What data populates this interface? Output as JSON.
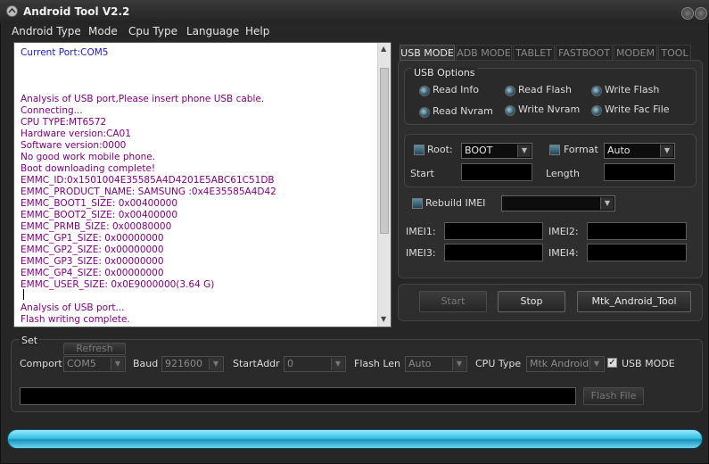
{
  "window": {
    "title": "Android Tool V2.2"
  },
  "menu": [
    "Android Type",
    "Mode",
    "Cpu Type",
    "Language",
    "Help"
  ],
  "log": {
    "lines": [
      {
        "text": "Current Port:COM5",
        "color": "#1a1ad0"
      },
      {
        "text": "",
        "color": "#800080"
      },
      {
        "text": "",
        "color": "#800080"
      },
      {
        "text": "",
        "color": "#800080"
      },
      {
        "text": "Analysis of USB port,Please insert phone USB cable.",
        "color": "#800080"
      },
      {
        "text": "Connecting...",
        "color": "#800080"
      },
      {
        "text": "CPU TYPE:MT6572",
        "color": "#800080"
      },
      {
        "text": "Hardware version:CA01",
        "color": "#800080"
      },
      {
        "text": "Software version:0000",
        "color": "#800080"
      },
      {
        "text": "No good work mobile phone.",
        "color": "#800080"
      },
      {
        "text": "Boot downloading complete!",
        "color": "#800080"
      },
      {
        "text": "EMMC_ID:0x1501004E35585A4D4201E5ABC61C51DB",
        "color": "#800080"
      },
      {
        "text": "EMMC_PRODUCT_NAME: SAMSUNG :0x4E35585A4D42",
        "color": "#800080"
      },
      {
        "text": "EMMC_BOOT1_SIZE: 0x00400000",
        "color": "#800080"
      },
      {
        "text": "EMMC_BOOT2_SIZE: 0x00400000",
        "color": "#800080"
      },
      {
        "text": "EMMC_PRMB_SIZE: 0x00080000",
        "color": "#800080"
      },
      {
        "text": "EMMC_GP1_SIZE: 0x00000000",
        "color": "#800080"
      },
      {
        "text": "EMMC_GP2_SIZE: 0x00000000",
        "color": "#800080"
      },
      {
        "text": "EMMC_GP3_SIZE: 0x00000000",
        "color": "#800080"
      },
      {
        "text": "EMMC_GP4_SIZE: 0x00000000",
        "color": "#800080"
      },
      {
        "text": "EMMC_USER_SIZE: 0x0E9000000(3.64 G)",
        "color": "#800080"
      },
      {
        "text": "",
        "color": "#800080"
      },
      {
        "text": "Analysis of USB port...",
        "color": "#800080"
      },
      {
        "text": "Flash writing complete.",
        "color": "#800080"
      }
    ]
  },
  "tabs": [
    "USB MODE",
    "ADB MODE",
    "TABLET",
    "FASTBOOT",
    "MODEM",
    "TOOL"
  ],
  "usb_options": {
    "title": "USB Options",
    "options": [
      "Read Info",
      "Read Flash",
      "Write Flash",
      "Read Nvram",
      "Write Nvram",
      "Write Fac File"
    ]
  },
  "root": {
    "label": "Root:",
    "value": "BOOT"
  },
  "format": {
    "label": "Format",
    "value": "Auto"
  },
  "start_label": "Start",
  "length_label": "Length",
  "rebuild_imei": {
    "label": "Rebuild IMEI",
    "value": ""
  },
  "imei_labels": [
    "IMEI1:",
    "IMEI2:",
    "IMEI3:",
    "IMEI4:"
  ],
  "actions": {
    "start": "Start",
    "stop": "Stop",
    "mtk": "Mtk_Android_Tool"
  },
  "set": {
    "title": "Set",
    "refresh": "Refresh",
    "comport_label": "Comport",
    "comport_value": "COM5",
    "baud_label": "Baud",
    "baud_value": "921600",
    "startaddr_label": "StartAddr",
    "startaddr_value": "0",
    "flashlen_label": "Flash Len",
    "flashlen_value": "Auto",
    "cputype_label": "CPU Type",
    "cputype_value": "Mtk Android",
    "usbmode_label": "USB MODE",
    "flash_file": "Flash File"
  },
  "progress": {
    "fraction": 1.0
  },
  "colors": {
    "accent": "#2eb4d8",
    "log_text": "#800080",
    "log_header": "#1a1ad0"
  }
}
